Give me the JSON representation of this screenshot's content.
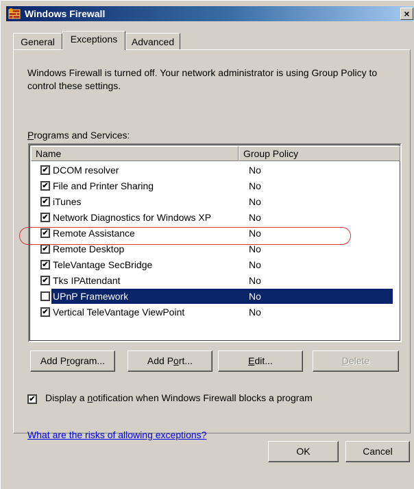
{
  "window": {
    "title": "Windows Firewall",
    "close_glyph": "×",
    "icon": "firewall-icon"
  },
  "tabs": [
    {
      "label": "General",
      "active": false
    },
    {
      "label": "Exceptions",
      "active": true
    },
    {
      "label": "Advanced",
      "active": false
    }
  ],
  "info_text": "Windows Firewall is turned off. Your network administrator is using Group Policy to control these settings.",
  "programs_label": {
    "mnemonic": "P",
    "rest": "rograms and Services:"
  },
  "list": {
    "columns": [
      "Name",
      "Group Policy"
    ],
    "rows": [
      {
        "name": "DCOM resolver",
        "group_policy": "No",
        "checked": true,
        "selected": false
      },
      {
        "name": "File and Printer Sharing",
        "group_policy": "No",
        "checked": true,
        "selected": false
      },
      {
        "name": "iTunes",
        "group_policy": "No",
        "checked": true,
        "selected": false
      },
      {
        "name": "Network Diagnostics for Windows XP",
        "group_policy": "No",
        "checked": true,
        "selected": false
      },
      {
        "name": "Remote Assistance",
        "group_policy": "No",
        "checked": true,
        "selected": false
      },
      {
        "name": "Remote Desktop",
        "group_policy": "No",
        "checked": true,
        "selected": false
      },
      {
        "name": "TeleVantage SecBridge",
        "group_policy": "No",
        "checked": true,
        "selected": false
      },
      {
        "name": "Tks IPAttendant",
        "group_policy": "No",
        "checked": true,
        "selected": false
      },
      {
        "name": "UPnP Framework",
        "group_policy": "No",
        "checked": false,
        "selected": true
      },
      {
        "name": "Vertical TeleVantage ViewPoint",
        "group_policy": "No",
        "checked": true,
        "selected": false
      }
    ]
  },
  "buttons": {
    "add_program": {
      "before": "Add P",
      "mnemonic": "r",
      "after": "ogram..."
    },
    "add_port": {
      "before": "Add P",
      "mnemonic": "o",
      "after": "rt..."
    },
    "edit": {
      "before": "",
      "mnemonic": "E",
      "after": "dit..."
    },
    "delete": {
      "before": "",
      "mnemonic": "D",
      "after": "elete"
    }
  },
  "notification": {
    "before": "Display a ",
    "mnemonic": "n",
    "after": "otification when Windows Firewall blocks a program",
    "checked": true
  },
  "risks_link": "What are the risks of allowing exceptions?",
  "footer": {
    "ok": "OK",
    "cancel": "Cancel"
  },
  "colors": {
    "selection": "#0a246a",
    "annotation": "#e03030",
    "link": "#0000ee"
  }
}
